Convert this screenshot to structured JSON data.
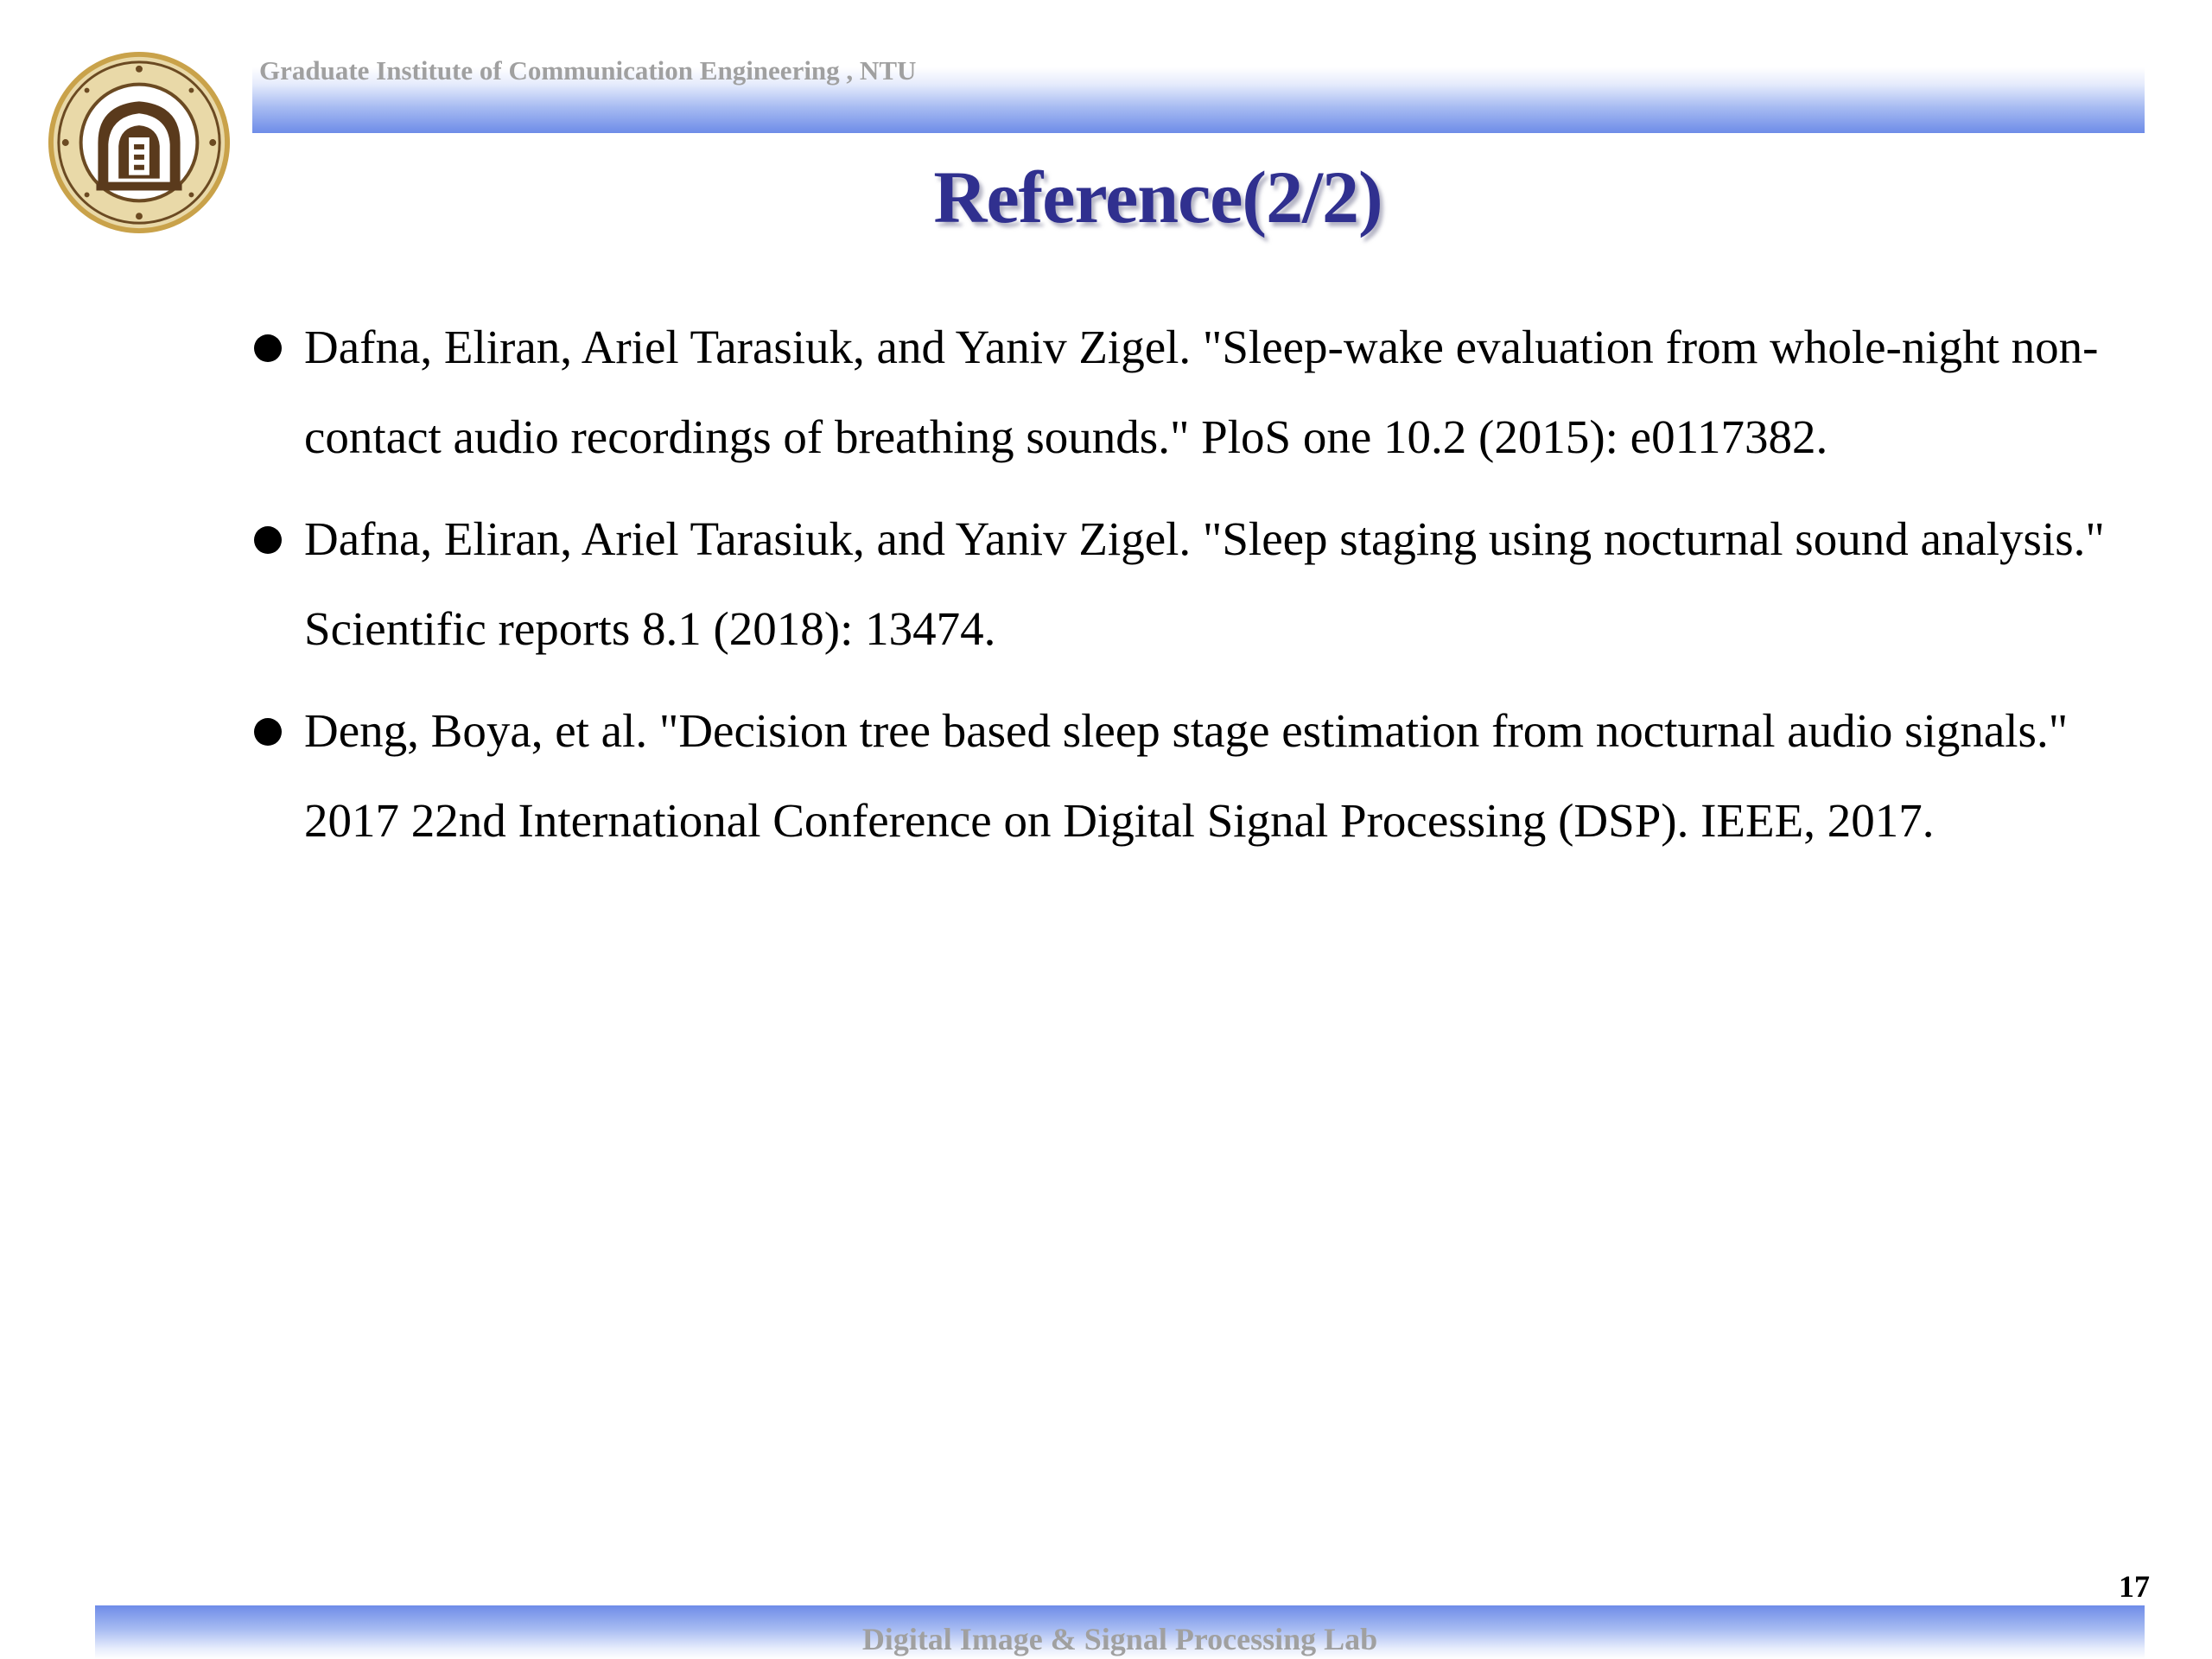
{
  "header": {
    "institute": "Graduate Institute of Communication Engineering , NTU"
  },
  "title": "Reference(2/2)",
  "references": [
    {
      "text": "Dafna, Eliran, Ariel Tarasiuk, and Yaniv Zigel. \"Sleep-wake evaluation from whole-night non-contact audio recordings of breathing sounds.\" PloS one 10.2 (2015): e0117382."
    },
    {
      "text": "Dafna, Eliran, Ariel Tarasiuk, and Yaniv Zigel. \"Sleep staging using nocturnal sound analysis.\" Scientific reports 8.1 (2018): 13474."
    },
    {
      "text": "Deng, Boya, et al. \"Decision tree based sleep stage estimation from nocturnal audio signals.\" 2017 22nd International Conference on Digital Signal Processing (DSP). IEEE, 2017."
    }
  ],
  "footer": {
    "page_number": "17",
    "lab_name": "Digital Image & Signal Processing Lab"
  },
  "colors": {
    "title": "#30308f",
    "band": "#6e8ce8",
    "header_text": "#a0a0a0",
    "seal_gold": "#c9a24a",
    "seal_brown": "#5a3a1c"
  }
}
